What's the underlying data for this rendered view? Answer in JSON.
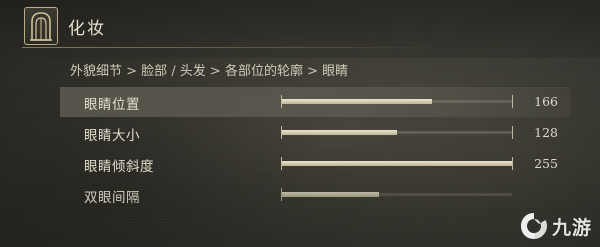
{
  "header": {
    "title": "化妆",
    "emblem_icon": "doorway-icon"
  },
  "breadcrumb": "外貌细节 > 脸部 / 头发 > 各部位的轮廓 > 眼睛",
  "sliders": [
    {
      "label": "眼睛位置",
      "value": "166",
      "fraction": 0.65,
      "selected": true
    },
    {
      "label": "眼睛大小",
      "value": "128",
      "fraction": 0.5,
      "selected": false
    },
    {
      "label": "眼睛倾斜度",
      "value": "255",
      "fraction": 1.0,
      "selected": false
    },
    {
      "label": "双眼间隔",
      "value": "",
      "fraction": 0.42,
      "selected": false
    }
  ],
  "watermark": {
    "text": "九游",
    "icon": "jiuyou-logo-icon"
  }
}
